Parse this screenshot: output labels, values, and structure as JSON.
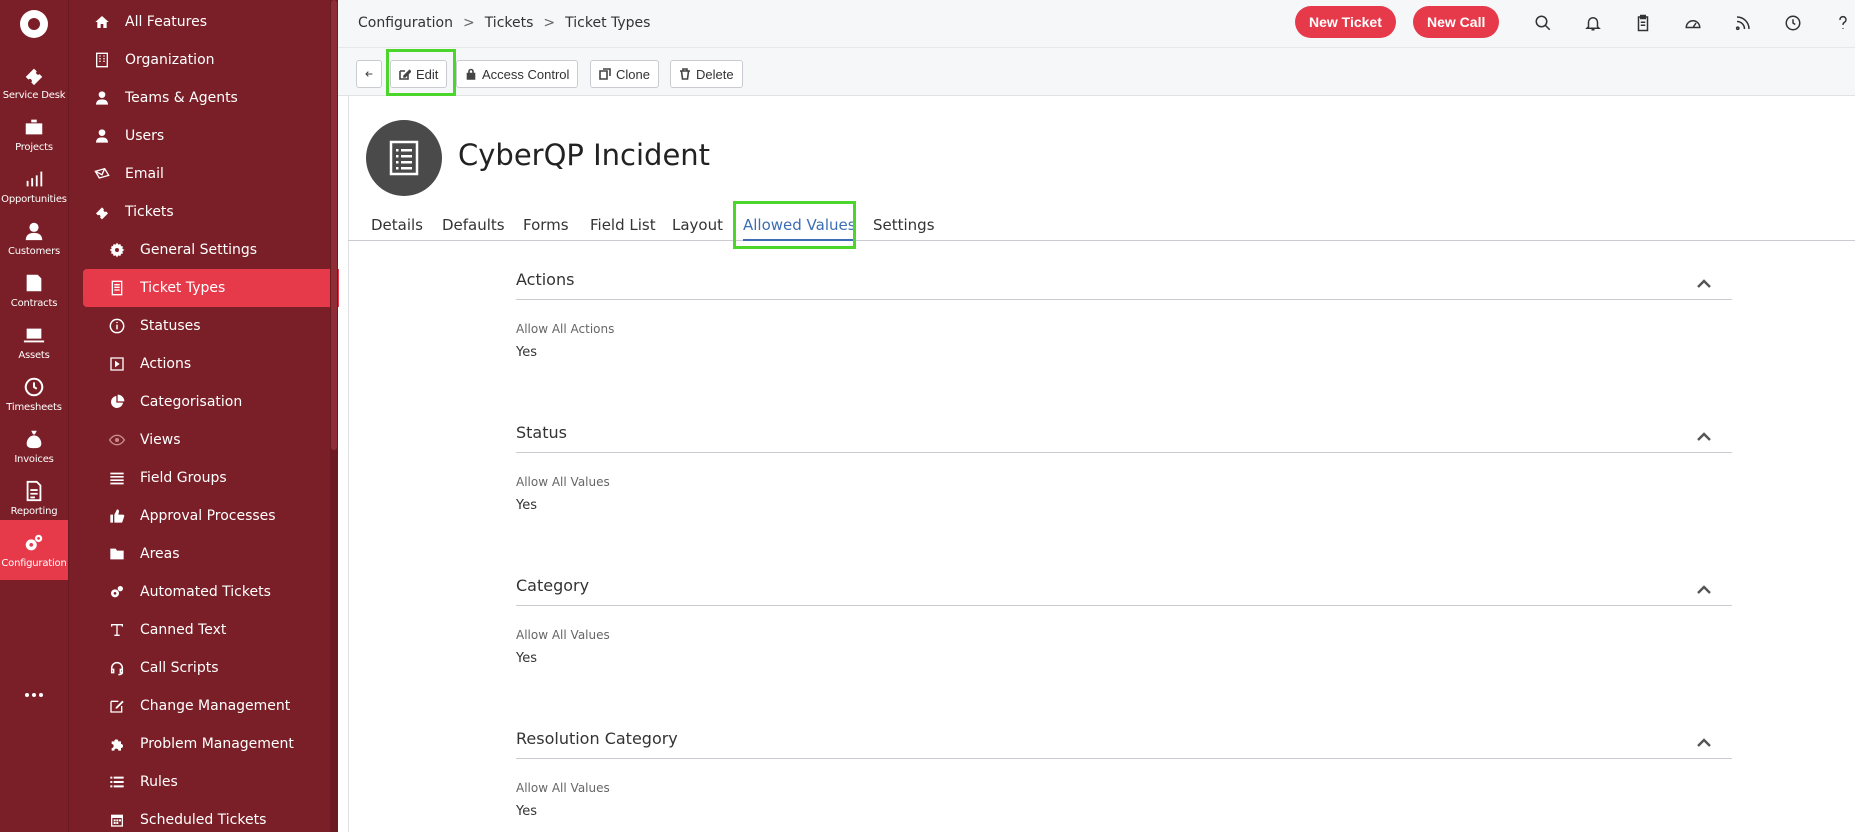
{
  "rail": {
    "items": [
      {
        "label": "Service Desk",
        "icon": "ticket-icon"
      },
      {
        "label": "Projects",
        "icon": "briefcase-icon"
      },
      {
        "label": "Opportunities",
        "icon": "chart-icon"
      },
      {
        "label": "Customers",
        "icon": "person-icon"
      },
      {
        "label": "Contracts",
        "icon": "contract-icon"
      },
      {
        "label": "Assets",
        "icon": "laptop-icon"
      },
      {
        "label": "Timesheets",
        "icon": "clock-icon"
      },
      {
        "label": "Invoices",
        "icon": "moneybag-icon"
      },
      {
        "label": "Reporting",
        "icon": "report-icon"
      },
      {
        "label": "Configuration",
        "icon": "gears-icon"
      }
    ]
  },
  "sidebar": {
    "items": [
      {
        "label": "All Features",
        "icon": "home-icon"
      },
      {
        "label": "Organization",
        "icon": "building-icon"
      },
      {
        "label": "Teams & Agents",
        "icon": "person-icon"
      },
      {
        "label": "Users",
        "icon": "person-icon"
      },
      {
        "label": "Email",
        "icon": "envelope-icon"
      },
      {
        "label": "Tickets",
        "icon": "ticket-icon"
      },
      {
        "label": "General Settings",
        "icon": "gear-icon"
      },
      {
        "label": "Ticket Types",
        "icon": "document-icon"
      },
      {
        "label": "Statuses",
        "icon": "info-icon"
      },
      {
        "label": "Actions",
        "icon": "play-icon"
      },
      {
        "label": "Categorisation",
        "icon": "pie-icon"
      },
      {
        "label": "Views",
        "icon": "eye-icon"
      },
      {
        "label": "Field Groups",
        "icon": "list-icon"
      },
      {
        "label": "Approval Processes",
        "icon": "thumbs-up-icon"
      },
      {
        "label": "Areas",
        "icon": "folder-icon"
      },
      {
        "label": "Automated Tickets",
        "icon": "gears-icon"
      },
      {
        "label": "Canned Text",
        "icon": "text-icon"
      },
      {
        "label": "Call Scripts",
        "icon": "headset-icon"
      },
      {
        "label": "Change Management",
        "icon": "edit-icon"
      },
      {
        "label": "Problem Management",
        "icon": "puzzle-icon"
      },
      {
        "label": "Rules",
        "icon": "list-icon"
      },
      {
        "label": "Scheduled Tickets",
        "icon": "calendar-icon"
      }
    ]
  },
  "topbar": {
    "breadcrumb": [
      "Configuration",
      "Tickets",
      "Ticket Types"
    ],
    "separator": ">",
    "new_ticket": "New Ticket",
    "new_call": "New Call"
  },
  "toolbar": {
    "edit": "Edit",
    "access_control": "Access Control",
    "clone": "Clone",
    "delete": "Delete"
  },
  "header": {
    "title": "CyberQP Incident"
  },
  "tabs": [
    "Details",
    "Defaults",
    "Forms",
    "Field List",
    "Layout",
    "Allowed Values",
    "Settings"
  ],
  "sections": [
    {
      "title": "Actions",
      "label": "Allow All Actions",
      "value": "Yes"
    },
    {
      "title": "Status",
      "label": "Allow All Values",
      "value": "Yes"
    },
    {
      "title": "Category",
      "label": "Allow All Values",
      "value": "Yes"
    },
    {
      "title": "Resolution Category",
      "label": "Allow All Values",
      "value": "Yes"
    }
  ],
  "colors": {
    "sidebar_bg": "#7a1f27",
    "accent_red": "#e63a4a",
    "active_tab": "#3d6db5",
    "highlight": "#4cd62b"
  }
}
